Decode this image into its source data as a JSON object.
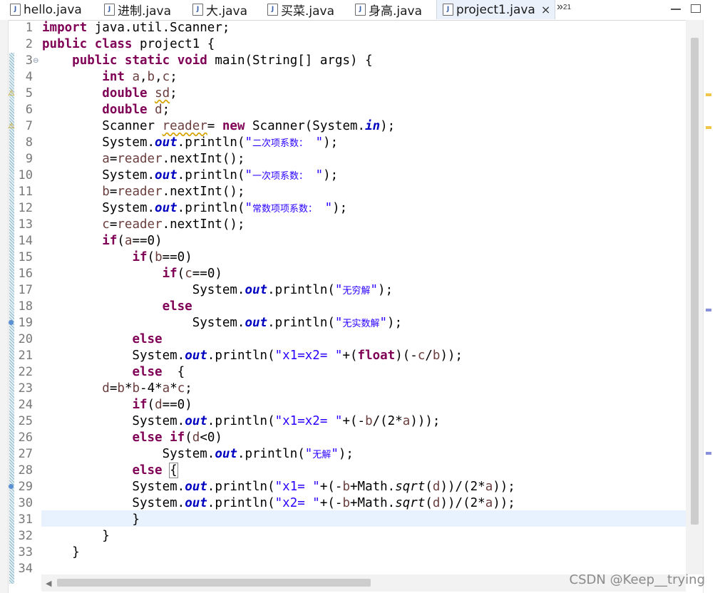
{
  "tabs": [
    {
      "label": "hello.java",
      "icon": "java-file-icon"
    },
    {
      "label": "进制.java",
      "icon": "java-file-icon"
    },
    {
      "label": "大.java",
      "icon": "java-file-icon"
    },
    {
      "label": "买菜.java",
      "icon": "java-file-icon"
    },
    {
      "label": "身高.java",
      "icon": "java-file-icon"
    },
    {
      "label": "project1.java",
      "icon": "java-file-icon",
      "active": true,
      "close": "×"
    }
  ],
  "tab_overflow": {
    "chevron": "»",
    "count": "21"
  },
  "editor": {
    "line_numbers": [
      "1",
      "2",
      "3",
      "4",
      "5",
      "6",
      "7",
      "8",
      "9",
      "10",
      "11",
      "12",
      "13",
      "14",
      "15",
      "16",
      "17",
      "18",
      "19",
      "20",
      "21",
      "22",
      "23",
      "24",
      "25",
      "26",
      "27",
      "28",
      "29",
      "30",
      "31",
      "32",
      "33",
      "34"
    ],
    "lines": [
      "import java.util.Scanner;",
      "public class project1 {",
      "    public static void main(String[] args) {",
      "        int a,b,c;",
      "        double sd;",
      "        double d;",
      "        Scanner reader= new Scanner(System.in);",
      "        System.out.println(\"二次项系数： \");",
      "        a=reader.nextInt();",
      "        System.out.println(\"一次项系数： \");",
      "        b=reader.nextInt();",
      "        System.out.println(\"常数项项系数： \");",
      "        c=reader.nextInt();",
      "        if(a==0)",
      "            if(b==0)",
      "                if(c==0)",
      "                    System.out.println(\"无穷解\");",
      "                else",
      "                    System.out.println(\"无实数解\");",
      "            else",
      "            System.out.println(\"x1=x2= \"+(float)(-c/b));",
      "            else  {",
      "        d=b*b-4*a*c;",
      "            if(d==0)",
      "            System.out.println(\"x1=x2= \"+(-b/(2*a)));",
      "            else if(d<0)",
      "                System.out.println(\"无解\");",
      "            else {",
      "            System.out.println(\"x1= \"+(-b+Math.sqrt(d))/(2*a));",
      "            System.out.println(\"x2= \"+(-b+Math.sqrt(d))/(2*a));",
      "            }",
      "        }",
      "    }",
      ""
    ]
  },
  "watermark": "CSDN @Keep__trying",
  "colors": {
    "keyword": "#7f0055",
    "field": "#0000c0",
    "string": "#2a00ff",
    "current_line": "#e8f2fe",
    "warning": "#d9a20c"
  }
}
